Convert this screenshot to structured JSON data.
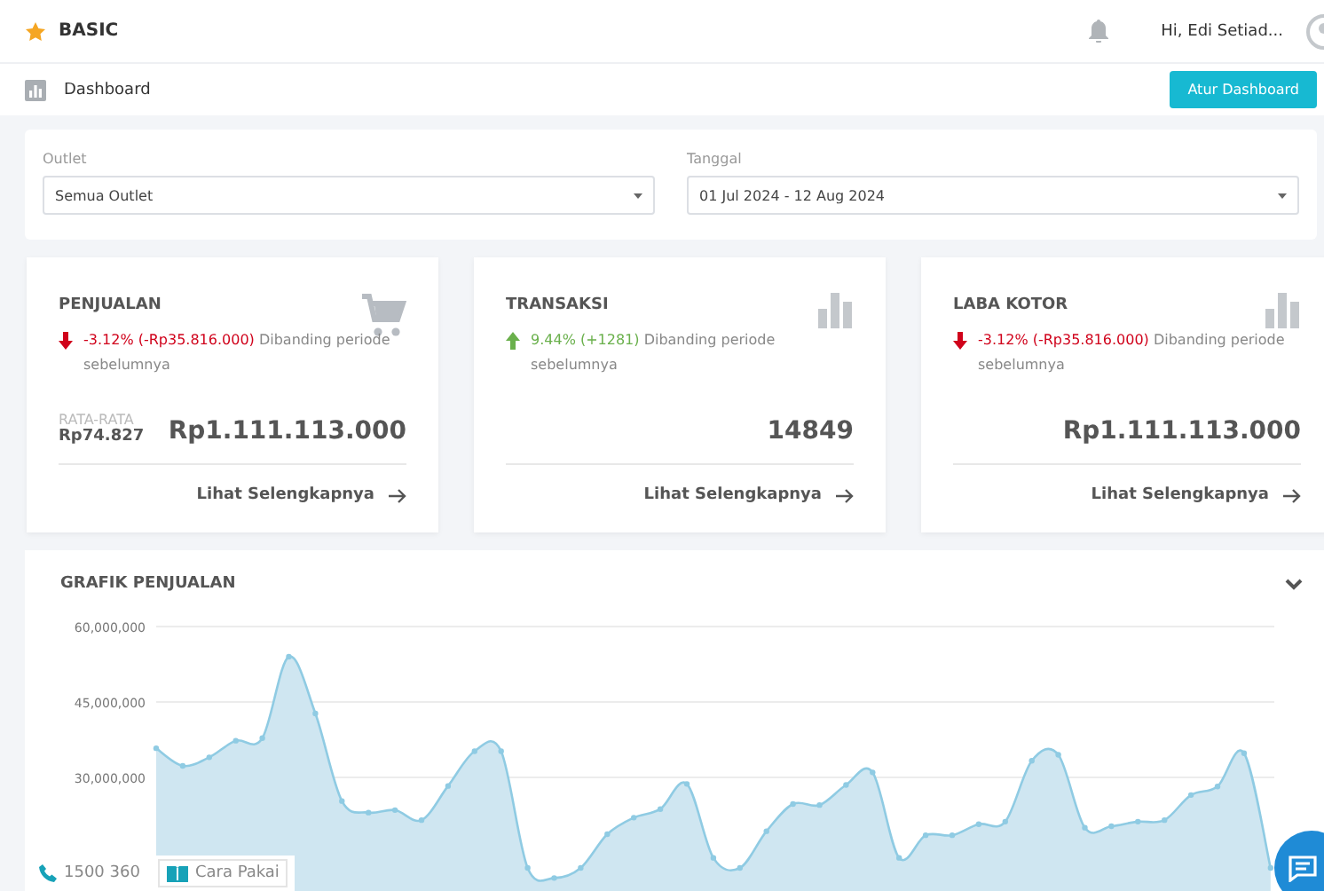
{
  "topbar": {
    "brand": "BASIC",
    "greeting": "Hi, Edi Setiad..."
  },
  "header": {
    "title": "Dashboard",
    "button": "Atur Dashboard"
  },
  "filters": [
    {
      "label": "Outlet",
      "value": "Semua Outlet"
    },
    {
      "label": "Tanggal",
      "value": "01 Jul 2024 - 12 Aug 2024"
    }
  ],
  "cards": [
    {
      "kind": "cart",
      "title": "PENJUALAN",
      "increase": false,
      "change": "-3.12% (-Rp35.816.000)",
      "note": "Dibanding periode sebelumnya",
      "avg_label": "RATA-RATA",
      "avg_value": "Rp74.827",
      "value": "Rp1.111.113.000",
      "link": "Lihat Selengkapnya"
    },
    {
      "kind": "bars",
      "title": "TRANSAKSI",
      "increase": true,
      "change": "9.44% (+1281)",
      "note": "Dibanding periode sebelumnya",
      "value": "14849",
      "link": "Lihat Selengkapnya"
    },
    {
      "kind": "bars",
      "title": "LABA KOTOR",
      "increase": false,
      "change": "-3.12% (-Rp35.816.000)",
      "note": "Dibanding periode sebelumnya",
      "value": "Rp1.111.113.000",
      "link": "Lihat Selengkapnya"
    }
  ],
  "sales_chart": {
    "title": "GRAFIK PENJUALAN",
    "chart_data": {
      "type": "area",
      "ylim": [
        0,
        60000000
      ],
      "yticks": [
        {
          "value": 30000000,
          "label": "30,000,000"
        },
        {
          "value": 45000000,
          "label": "45,000,000"
        },
        {
          "value": 60000000,
          "label": "60,000,000"
        }
      ],
      "series": [
        {
          "color": "#8fcbe3",
          "values": [
            35800000,
            32300000,
            34000000,
            37300000,
            37800000,
            54000000,
            42700000,
            25300000,
            23000000,
            23500000,
            21500000,
            28300000,
            35200000,
            35200000,
            12000000,
            10000000,
            12000000,
            18700000,
            22000000,
            23700000,
            28700000,
            14000000,
            12000000,
            19300000,
            24700000,
            24500000,
            28500000,
            31000000,
            14000000,
            18500000,
            18500000,
            20700000,
            21200000,
            33300000,
            34500000,
            20000000,
            20300000,
            21200000,
            21500000,
            26500000,
            28200000,
            34800000,
            12000000
          ]
        }
      ]
    }
  },
  "footer": {
    "phone": "1500 360",
    "guide": "Cara Pakai"
  }
}
